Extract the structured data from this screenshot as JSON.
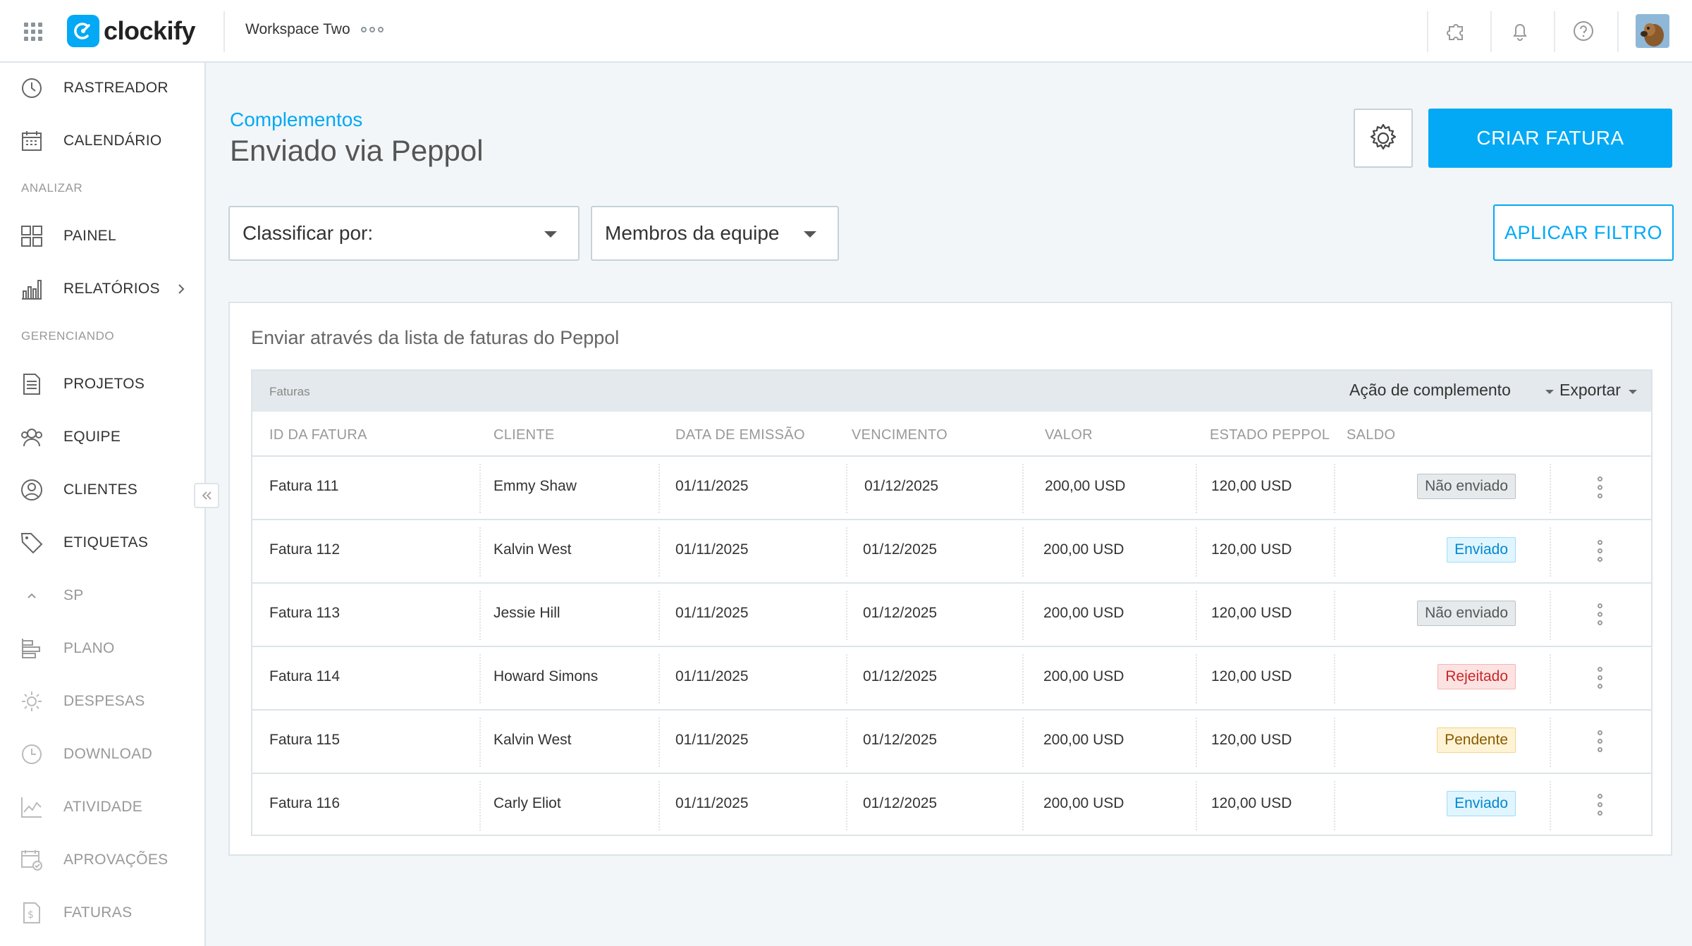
{
  "app": {
    "logo_text": "clockify",
    "workspace": "Workspace Two"
  },
  "sidebar": {
    "items": [
      {
        "label": "RASTREADOR",
        "icon": "clock-icon"
      },
      {
        "label": "CALENDÁRIO",
        "icon": "calendar-icon"
      },
      {
        "label": "PAINEL",
        "icon": "dashboard-icon"
      },
      {
        "label": "RELATÓRIOS",
        "icon": "bar-chart-icon"
      },
      {
        "label": "PROJETOS",
        "icon": "document-icon"
      },
      {
        "label": "EQUIPE",
        "icon": "team-icon"
      },
      {
        "label": "CLIENTES",
        "icon": "client-icon"
      },
      {
        "label": "ETIQUETAS",
        "icon": "tag-icon"
      },
      {
        "label": "SP",
        "icon": "chevron-up-icon"
      },
      {
        "label": "PLANO",
        "icon": "schedule-icon"
      },
      {
        "label": "DESPESAS",
        "icon": "expense-icon"
      },
      {
        "label": "DOWNLOAD",
        "icon": "download-clock-icon"
      },
      {
        "label": "ATIVIDADE",
        "icon": "activity-icon"
      },
      {
        "label": "APROVAÇÕES",
        "icon": "approval-icon"
      },
      {
        "label": "FATURAS",
        "icon": "invoice-icon"
      }
    ],
    "section_analyze": "ANALIZAR",
    "section_manage": "GERENCIANDO"
  },
  "header": {
    "breadcrumb": "Complementos",
    "title": "Enviado via Peppol",
    "create_button": "CRIAR FATURA"
  },
  "filters": {
    "sort_by": "Classificar por:",
    "team_members": "Membros da equipe",
    "apply_button": "APLICAR FILTRO"
  },
  "card": {
    "title": "Enviar através da lista de faturas do Peppol",
    "table_label": "Faturas",
    "action_menu": "Ação de complemento",
    "export_menu": "Exportar"
  },
  "table": {
    "columns": [
      "ID DA FATURA",
      "CLIENTE",
      "DATA DE EMISSÃO",
      "VENCIMENTO",
      "VALOR",
      "ESTADO PEPPOL",
      "SALDO"
    ],
    "rows": [
      {
        "id": "Fatura 111",
        "client": "Emmy Shaw",
        "issue": "01/11/2025",
        "due": "01/12/2025",
        "amount": "200,00 USD",
        "balance": "120,00 USD",
        "status": "Não enviado",
        "status_type": "notsent"
      },
      {
        "id": "Fatura 112",
        "client": "Kalvin West",
        "issue": "01/11/2025",
        "due": "01/12/2025",
        "amount": "200,00 USD",
        "balance": "120,00 USD",
        "status": "Enviado",
        "status_type": "sent"
      },
      {
        "id": "Fatura 113",
        "client": "Jessie Hill",
        "issue": "01/11/2025",
        "due": "01/12/2025",
        "amount": "200,00 USD",
        "balance": "120,00 USD",
        "status": "Não enviado",
        "status_type": "notsent"
      },
      {
        "id": "Fatura 114",
        "client": "Howard Simons",
        "issue": "01/11/2025",
        "due": "01/12/2025",
        "amount": "200,00 USD",
        "balance": "120,00 USD",
        "status": "Rejeitado",
        "status_type": "rejected"
      },
      {
        "id": "Fatura 115",
        "client": "Kalvin West",
        "issue": "01/11/2025",
        "due": "01/12/2025",
        "amount": "200,00 USD",
        "balance": "120,00 USD",
        "status": "Pendente",
        "status_type": "pending"
      },
      {
        "id": "Fatura 116",
        "client": "Carly Eliot",
        "issue": "01/11/2025",
        "due": "01/12/2025",
        "amount": "200,00 USD",
        "balance": "120,00 USD",
        "status": "Enviado",
        "status_type": "sent"
      }
    ]
  },
  "colors": {
    "accent": "#03a9f4",
    "background": "#f2f6f8"
  }
}
